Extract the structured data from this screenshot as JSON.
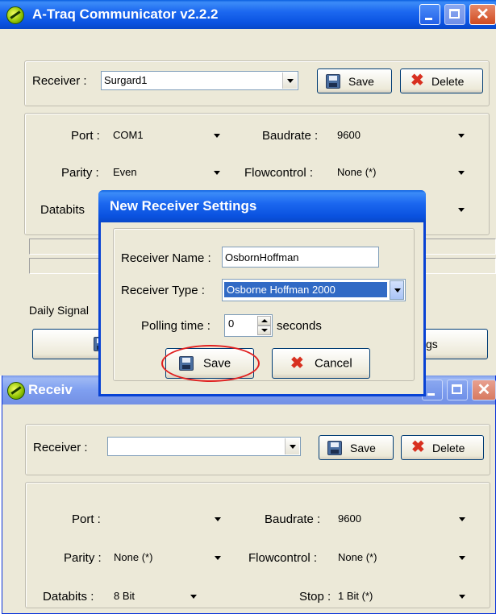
{
  "main_window": {
    "title": "A-Traq Communicator v2.2.2",
    "receiver_label": "Receiver :",
    "receiver_value": "Surgard1",
    "save_label": "Save",
    "delete_label": "Delete",
    "port_label": "Port :",
    "port_value": "COM1",
    "baudrate_label": "Baudrate :",
    "baudrate_value": "9600",
    "parity_label": "Parity :",
    "parity_value": "Even",
    "flowcontrol_label": "Flowcontrol :",
    "flowcontrol_value": "None (*)",
    "databits_label": "Databits",
    "daily_signal_label": "Daily Signal",
    "settings_button_partial": "gs"
  },
  "second_window": {
    "title": "Receiv",
    "receiver_label": "Receiver :",
    "receiver_value": "",
    "save_label": "Save",
    "delete_label": "Delete",
    "port_label": "Port :",
    "port_value": "",
    "baudrate_label": "Baudrate :",
    "baudrate_value": "9600",
    "parity_label": "Parity :",
    "parity_value": "None (*)",
    "flowcontrol_label": "Flowcontrol :",
    "flowcontrol_value": "None (*)",
    "databits_label": "Databits :",
    "databits_value": "8 Bit",
    "stop_label": "Stop :",
    "stop_value": "1 Bit (*)"
  },
  "dialog": {
    "title": "New Receiver Settings",
    "name_label": "Receiver Name :",
    "name_value": "OsbornHoffman",
    "type_label": "Receiver Type :",
    "type_value": "Osborne Hoffman 2000",
    "polling_label": "Polling time :",
    "polling_value": "0",
    "polling_unit": "seconds",
    "save_label": "Save",
    "cancel_label": "Cancel"
  },
  "colors": {
    "highlight_circle": "#e02020",
    "selection": "#316ac5"
  }
}
